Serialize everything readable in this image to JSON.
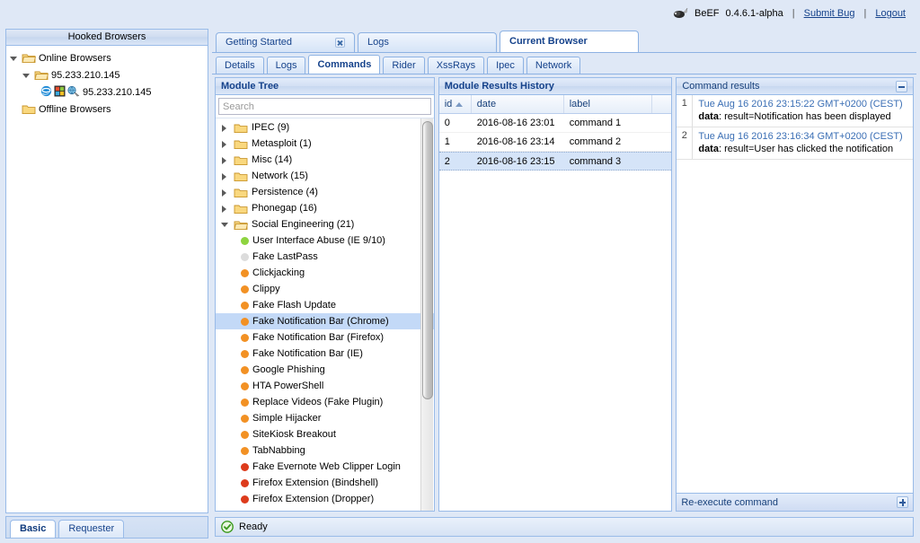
{
  "topbar": {
    "brand_icon": "beef-icon",
    "app_name": "BeEF",
    "version": "0.4.6.1-alpha",
    "separator": "|",
    "submit_bug": "Submit  Bug",
    "logout": "Logout"
  },
  "hooked_browsers": {
    "title": "Hooked Browsers",
    "online_label": "Online Browsers",
    "host_label": "95.233.210.145",
    "browser_label": "95.233.210.145",
    "browser_icons": [
      "ie-icon",
      "windows-icon",
      "network-icon"
    ],
    "offline_label": "Offline Browsers"
  },
  "left_tabs": [
    {
      "label": "Basic",
      "active": true
    },
    {
      "label": "Requester",
      "active": false
    }
  ],
  "main_tabs": [
    {
      "label": "Getting Started",
      "active": false,
      "closable": true
    },
    {
      "label": "Logs",
      "active": false,
      "closable": false
    },
    {
      "label": "Current Browser",
      "active": true,
      "closable": false
    }
  ],
  "sub_tabs": [
    {
      "label": "Details",
      "active": false
    },
    {
      "label": "Logs",
      "active": false
    },
    {
      "label": "Commands",
      "active": true
    },
    {
      "label": "Rider",
      "active": false
    },
    {
      "label": "XssRays",
      "active": false
    },
    {
      "label": "Ipec",
      "active": false
    },
    {
      "label": "Network",
      "active": false
    }
  ],
  "module_tree": {
    "title": "Module Tree",
    "search_placeholder": "Search",
    "search_value": "",
    "folders": [
      {
        "label": "IPEC (9)",
        "open": false
      },
      {
        "label": "Metasploit (1)",
        "open": false
      },
      {
        "label": "Misc (14)",
        "open": false
      },
      {
        "label": "Network (15)",
        "open": false
      },
      {
        "label": "Persistence (4)",
        "open": false
      },
      {
        "label": "Phonegap (16)",
        "open": false
      },
      {
        "label": "Social Engineering (21)",
        "open": true
      }
    ],
    "modules": [
      {
        "label": "User Interface Abuse (IE 9/10)",
        "status": "#8ed43f",
        "selected": false
      },
      {
        "label": "Fake LastPass",
        "status": "#dcdcdc",
        "selected": false
      },
      {
        "label": "Clickjacking",
        "status": "#f29124",
        "selected": false
      },
      {
        "label": "Clippy",
        "status": "#f29124",
        "selected": false
      },
      {
        "label": "Fake Flash Update",
        "status": "#f29124",
        "selected": false
      },
      {
        "label": "Fake Notification Bar (Chrome)",
        "status": "#f29124",
        "selected": true
      },
      {
        "label": "Fake Notification Bar (Firefox)",
        "status": "#f29124",
        "selected": false
      },
      {
        "label": "Fake Notification Bar (IE)",
        "status": "#f29124",
        "selected": false
      },
      {
        "label": "Google Phishing",
        "status": "#f29124",
        "selected": false
      },
      {
        "label": "HTA PowerShell",
        "status": "#f29124",
        "selected": false
      },
      {
        "label": "Replace Videos (Fake Plugin)",
        "status": "#f29124",
        "selected": false
      },
      {
        "label": "Simple Hijacker",
        "status": "#f29124",
        "selected": false
      },
      {
        "label": "SiteKiosk Breakout",
        "status": "#f29124",
        "selected": false
      },
      {
        "label": "TabNabbing",
        "status": "#f29124",
        "selected": false
      },
      {
        "label": "Fake Evernote Web Clipper Login",
        "status": "#dd3b1c",
        "selected": false
      },
      {
        "label": "Firefox Extension (Bindshell)",
        "status": "#dd3b1c",
        "selected": false
      },
      {
        "label": "Firefox Extension (Dropper)",
        "status": "#dd3b1c",
        "selected": false
      }
    ]
  },
  "results_history": {
    "title": "Module Results History",
    "columns": [
      "id",
      "date",
      "label",
      ""
    ],
    "sort_column": "id",
    "sort_direction": "asc",
    "rows": [
      {
        "id": "0",
        "date": "2016-08-16 23:01",
        "label": "command 1",
        "selected": false
      },
      {
        "id": "1",
        "date": "2016-08-16 23:14",
        "label": "command 2",
        "selected": false
      },
      {
        "id": "2",
        "date": "2016-08-16 23:15",
        "label": "command 3",
        "selected": true
      }
    ]
  },
  "command_results": {
    "title": "Command results",
    "collapse_icon": "minus-icon",
    "entries": [
      {
        "num": "1",
        "date": "Tue Aug 16 2016 23:15:22 GMT+0200 (CEST)",
        "key": "data",
        "value": ": result=Notification has been displayed"
      },
      {
        "num": "2",
        "date": "Tue Aug 16 2016 23:16:34 GMT+0200 (CEST)",
        "key": "data",
        "value": ": result=User has clicked the notification"
      }
    ],
    "footer_label": "Re-execute command",
    "footer_icon": "plus-icon"
  },
  "statusbar": {
    "icon": "ready-check-icon",
    "text": "Ready"
  }
}
